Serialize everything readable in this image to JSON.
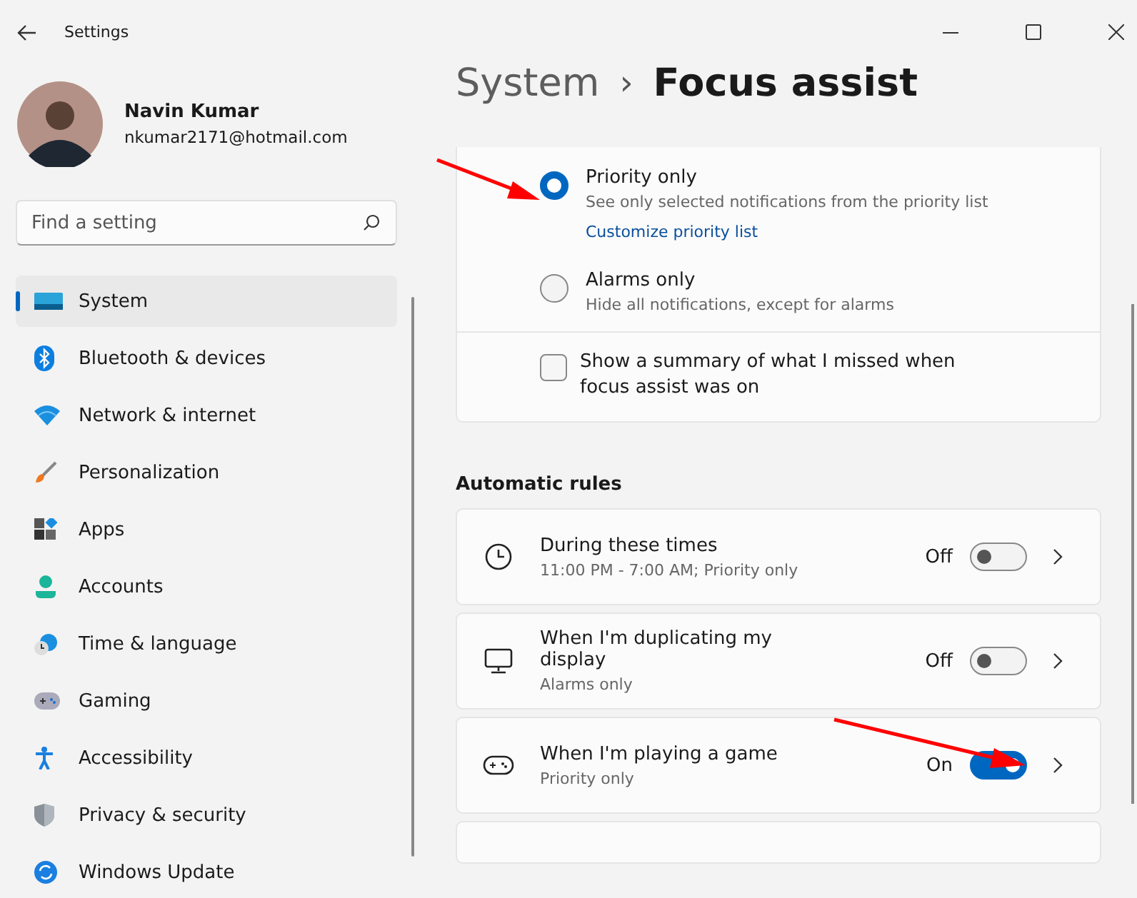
{
  "window": {
    "title": "Settings"
  },
  "profile": {
    "name": "Navin Kumar",
    "email": "nkumar2171@hotmail.com"
  },
  "search": {
    "placeholder": "Find a setting"
  },
  "sidebar": {
    "items": [
      {
        "label": "System",
        "kind": "system",
        "selected": true
      },
      {
        "label": "Bluetooth & devices",
        "kind": "bluetooth",
        "selected": false
      },
      {
        "label": "Network & internet",
        "kind": "network",
        "selected": false
      },
      {
        "label": "Personalization",
        "kind": "brush",
        "selected": false
      },
      {
        "label": "Apps",
        "kind": "apps",
        "selected": false
      },
      {
        "label": "Accounts",
        "kind": "person",
        "selected": false
      },
      {
        "label": "Time & language",
        "kind": "globe",
        "selected": false
      },
      {
        "label": "Gaming",
        "kind": "gamepad",
        "selected": false
      },
      {
        "label": "Accessibility",
        "kind": "accessibility",
        "selected": false
      },
      {
        "label": "Privacy & security",
        "kind": "shield",
        "selected": false
      },
      {
        "label": "Windows Update",
        "kind": "update",
        "selected": false
      }
    ]
  },
  "breadcrumb": {
    "parent": "System",
    "separator": "›",
    "current": "Focus assist"
  },
  "options": [
    {
      "title": "Priority only",
      "description": "See only selected notifications from the priority list",
      "link": "Customize priority list",
      "selected": true
    },
    {
      "title": "Alarms only",
      "description": "Hide all notifications, except for alarms",
      "selected": false
    }
  ],
  "summary_checkbox": {
    "label": "Show a summary of what I missed when focus assist was on",
    "checked": false
  },
  "automatic_rules": {
    "heading": "Automatic rules",
    "rules": [
      {
        "title": "During these times",
        "subtitle": "11:00 PM - 7:00 AM; Priority only",
        "kind": "clock",
        "state_label": "Off",
        "on": false,
        "arrow": false
      },
      {
        "title": "When I'm duplicating my display",
        "subtitle": "Alarms only",
        "kind": "monitor",
        "state_label": "Off",
        "on": false,
        "arrow": false
      },
      {
        "title": "When I'm playing a game",
        "subtitle": "Priority only",
        "kind": "gamepad",
        "state_label": "On",
        "on": true,
        "arrow": true
      }
    ]
  }
}
